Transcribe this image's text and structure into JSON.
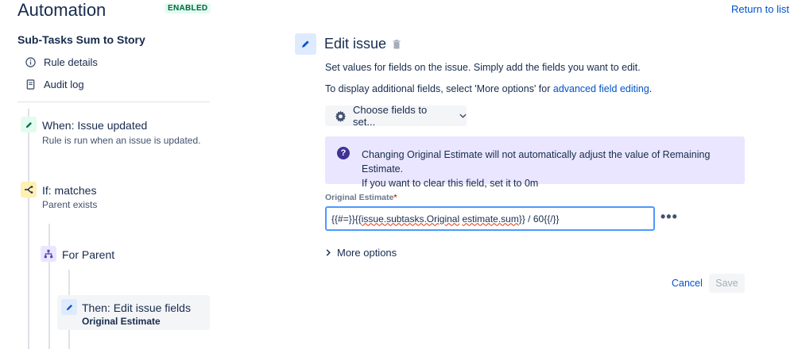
{
  "header": {
    "title": "Automation",
    "status_badge": "ENABLED",
    "return_link": "Return to list"
  },
  "sidebar": {
    "rule_name": "Sub-Tasks Sum to Story",
    "links": [
      {
        "label": "Rule details",
        "icon": "info-icon"
      },
      {
        "label": "Audit log",
        "icon": "document-icon"
      }
    ],
    "steps": {
      "trigger": {
        "title": "When: Issue updated",
        "subtitle": "Rule is run when an issue is updated.",
        "icon": "pencil-icon",
        "color": "#e3fcef"
      },
      "condition": {
        "title": "If: matches",
        "subtitle": "Parent exists",
        "icon": "branch-icon",
        "color": "#fff0b3"
      },
      "branch": {
        "title": "For Parent",
        "icon": "hierarchy-icon",
        "color": "#eae6ff"
      },
      "action": {
        "title": "Then: Edit issue fields",
        "subtitle": "Original Estimate",
        "icon": "pencil-icon",
        "color": "#deebff"
      }
    }
  },
  "main": {
    "title": "Edit issue",
    "desc1": "Set values for fields on the issue. Simply add the fields you want to edit.",
    "desc2_prefix": "To display additional fields, select 'More options' for ",
    "desc2_link": "advanced field editing",
    "desc2_suffix": ".",
    "choose_fields": "Choose fields to set...",
    "info_line1": "Changing Original Estimate will not automatically adjust the value of Remaining Estimate.",
    "info_line2": "If you want to clear this field, set it to 0m",
    "field_label": "Original Estimate",
    "field_required": "*",
    "field_value_prefix": "{{#=}}{{",
    "field_value_squiggle1": "issue.subtasks.Original",
    "field_value_space": " ",
    "field_value_squiggle2": "estimate.sum",
    "field_value_suffix": "}} / 60{{/}}",
    "more_dots": "•••",
    "more_options": "More options",
    "cancel": "Cancel",
    "save": "Save"
  }
}
